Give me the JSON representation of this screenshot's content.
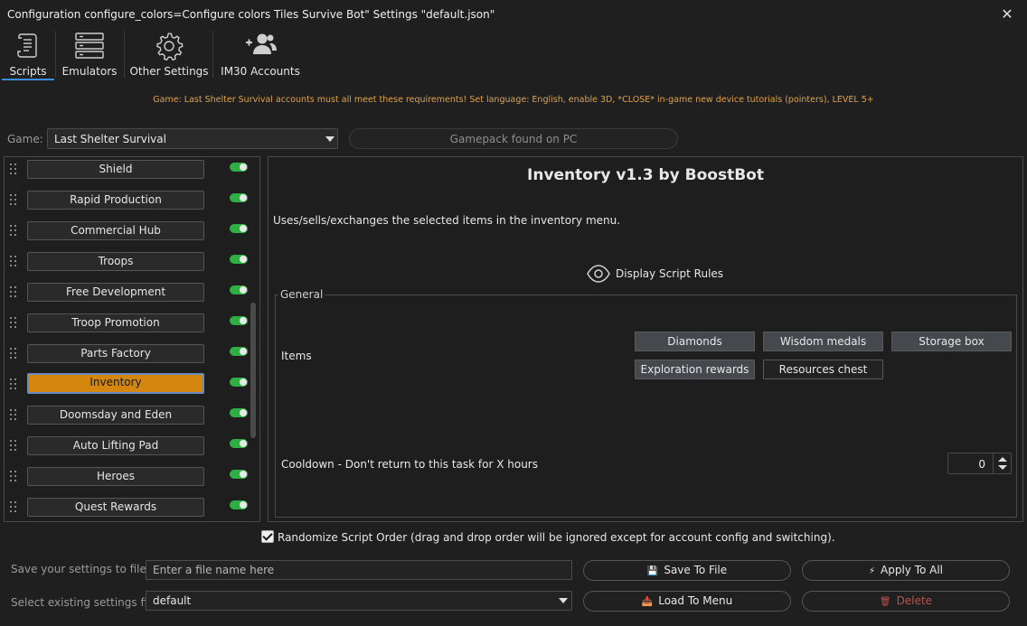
{
  "window": {
    "title": "Configuration configure_colors=Configure colors Tiles Survive Bot\" Settings \"default.json\"",
    "close_glyph": "✕"
  },
  "tabs": [
    {
      "label": "Scripts",
      "icon": "scroll-icon",
      "active": true
    },
    {
      "label": "Emulators",
      "icon": "server-icon"
    },
    {
      "label": "Other Settings",
      "icon": "gear-icon"
    },
    {
      "label": "IM30 Accounts",
      "icon": "users-icon"
    }
  ],
  "warning": "Game: Last Shelter Survival accounts must all meet these requirements! Set language: English, enable 3D, *CLOSE* in-game new device tutorials (pointers), LEVEL 5+",
  "game": {
    "label": "Game:",
    "selected": "Last Shelter Survival",
    "gamepack_status": "Gamepack found on PC"
  },
  "scripts": [
    {
      "label": "Shield",
      "enabled": true
    },
    {
      "label": "Rapid Production",
      "enabled": true
    },
    {
      "label": "Commercial Hub",
      "enabled": true
    },
    {
      "label": "Troops",
      "enabled": true
    },
    {
      "label": "Free Development",
      "enabled": true
    },
    {
      "label": "Troop Promotion",
      "enabled": true
    },
    {
      "label": "Parts Factory",
      "enabled": true
    },
    {
      "label": "Inventory",
      "enabled": true,
      "active": true
    },
    {
      "label": "Doomsday and Eden",
      "enabled": true
    },
    {
      "label": "Auto Lifting Pad",
      "enabled": true
    },
    {
      "label": "Heroes",
      "enabled": true
    },
    {
      "label": "Quest Rewards",
      "enabled": true
    }
  ],
  "detail": {
    "title": "Inventory v1.3 by BoostBot",
    "description": "Uses/sells/exchanges the selected items in the inventory menu.",
    "rules_link": "Display Script Rules",
    "group_label": "General",
    "items_label": "Items",
    "items": [
      {
        "label": "Diamonds",
        "selected": true
      },
      {
        "label": "Wisdom medals",
        "selected": true
      },
      {
        "label": "Storage box",
        "selected": true
      },
      {
        "label": "Exploration rewards",
        "selected": true
      },
      {
        "label": "Resources chest",
        "selected": false
      }
    ],
    "cooldown_label": "Cooldown - Don't return to this task for X hours",
    "cooldown_value": "0"
  },
  "randomize": {
    "checked": true,
    "label": "Randomize Script Order (drag and drop order will be ignored except for account config and switching)."
  },
  "bottom": {
    "save_label": "Save your settings to file",
    "file_placeholder": "Enter a file name here",
    "select_label": "Select existing settings file",
    "selected_file": "default",
    "save_button": "Save To File",
    "apply_button": "Apply To All",
    "load_button": "Load To Menu",
    "delete_button": "Delete"
  },
  "colors": {
    "background": "#1f1f1f",
    "active_script": "#d4860e",
    "toggle_on": "#2fae44",
    "warning_text": "#e0a24a",
    "tab_accent": "#3a8ddc",
    "delete_text": "#c0504d"
  }
}
